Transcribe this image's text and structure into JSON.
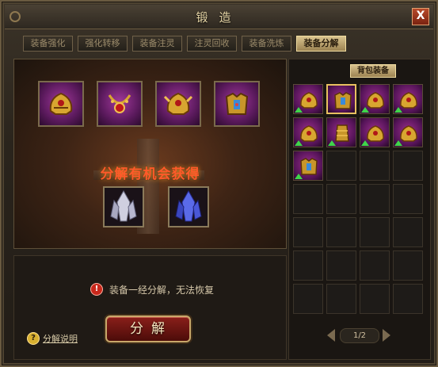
{
  "window": {
    "title": "锻造",
    "close_label": "X"
  },
  "tabs": [
    {
      "label": "装备强化",
      "active": false
    },
    {
      "label": "强化转移",
      "active": false
    },
    {
      "label": "装备注灵",
      "active": false
    },
    {
      "label": "注灵回收",
      "active": false
    },
    {
      "label": "装备洗炼",
      "active": false
    },
    {
      "label": "装备分解",
      "active": true
    }
  ],
  "decompose_panel": {
    "equipped_slots": [
      "helmet-icon",
      "necklace-icon",
      "helmet-icon",
      "armor-icon"
    ],
    "reward_text": "分解有机会获得",
    "reward_items": [
      "white-crystal-icon",
      "blue-crystal-icon"
    ]
  },
  "bottom": {
    "warning_icon": "!",
    "warning_text": "装备一经分解，无法恢复",
    "help_icon": "?",
    "help_text": "分解说明",
    "decompose_button": "分解"
  },
  "bag": {
    "tab_label": "背包装备",
    "items": [
      {
        "icon": "helmet-icon",
        "upgrade": true,
        "selected": false
      },
      {
        "icon": "armor-icon",
        "upgrade": false,
        "selected": true
      },
      {
        "icon": "helmet-icon",
        "upgrade": true,
        "selected": false
      },
      {
        "icon": "helmet-icon",
        "upgrade": true,
        "selected": false
      },
      {
        "icon": "helmet-icon",
        "upgrade": true,
        "selected": false
      },
      {
        "icon": "bracer-icon",
        "upgrade": true,
        "selected": false
      },
      {
        "icon": "helmet-icon",
        "upgrade": true,
        "selected": false
      },
      {
        "icon": "helmet-icon",
        "upgrade": true,
        "selected": false
      },
      {
        "icon": "armor-icon",
        "upgrade": true,
        "selected": false
      }
    ],
    "page": "1/2"
  },
  "colors": {
    "accent": "#e8c060",
    "warning": "#c8281c",
    "reward_text": "#ff5a2a",
    "upgrade_arrow": "#3fd54a"
  }
}
